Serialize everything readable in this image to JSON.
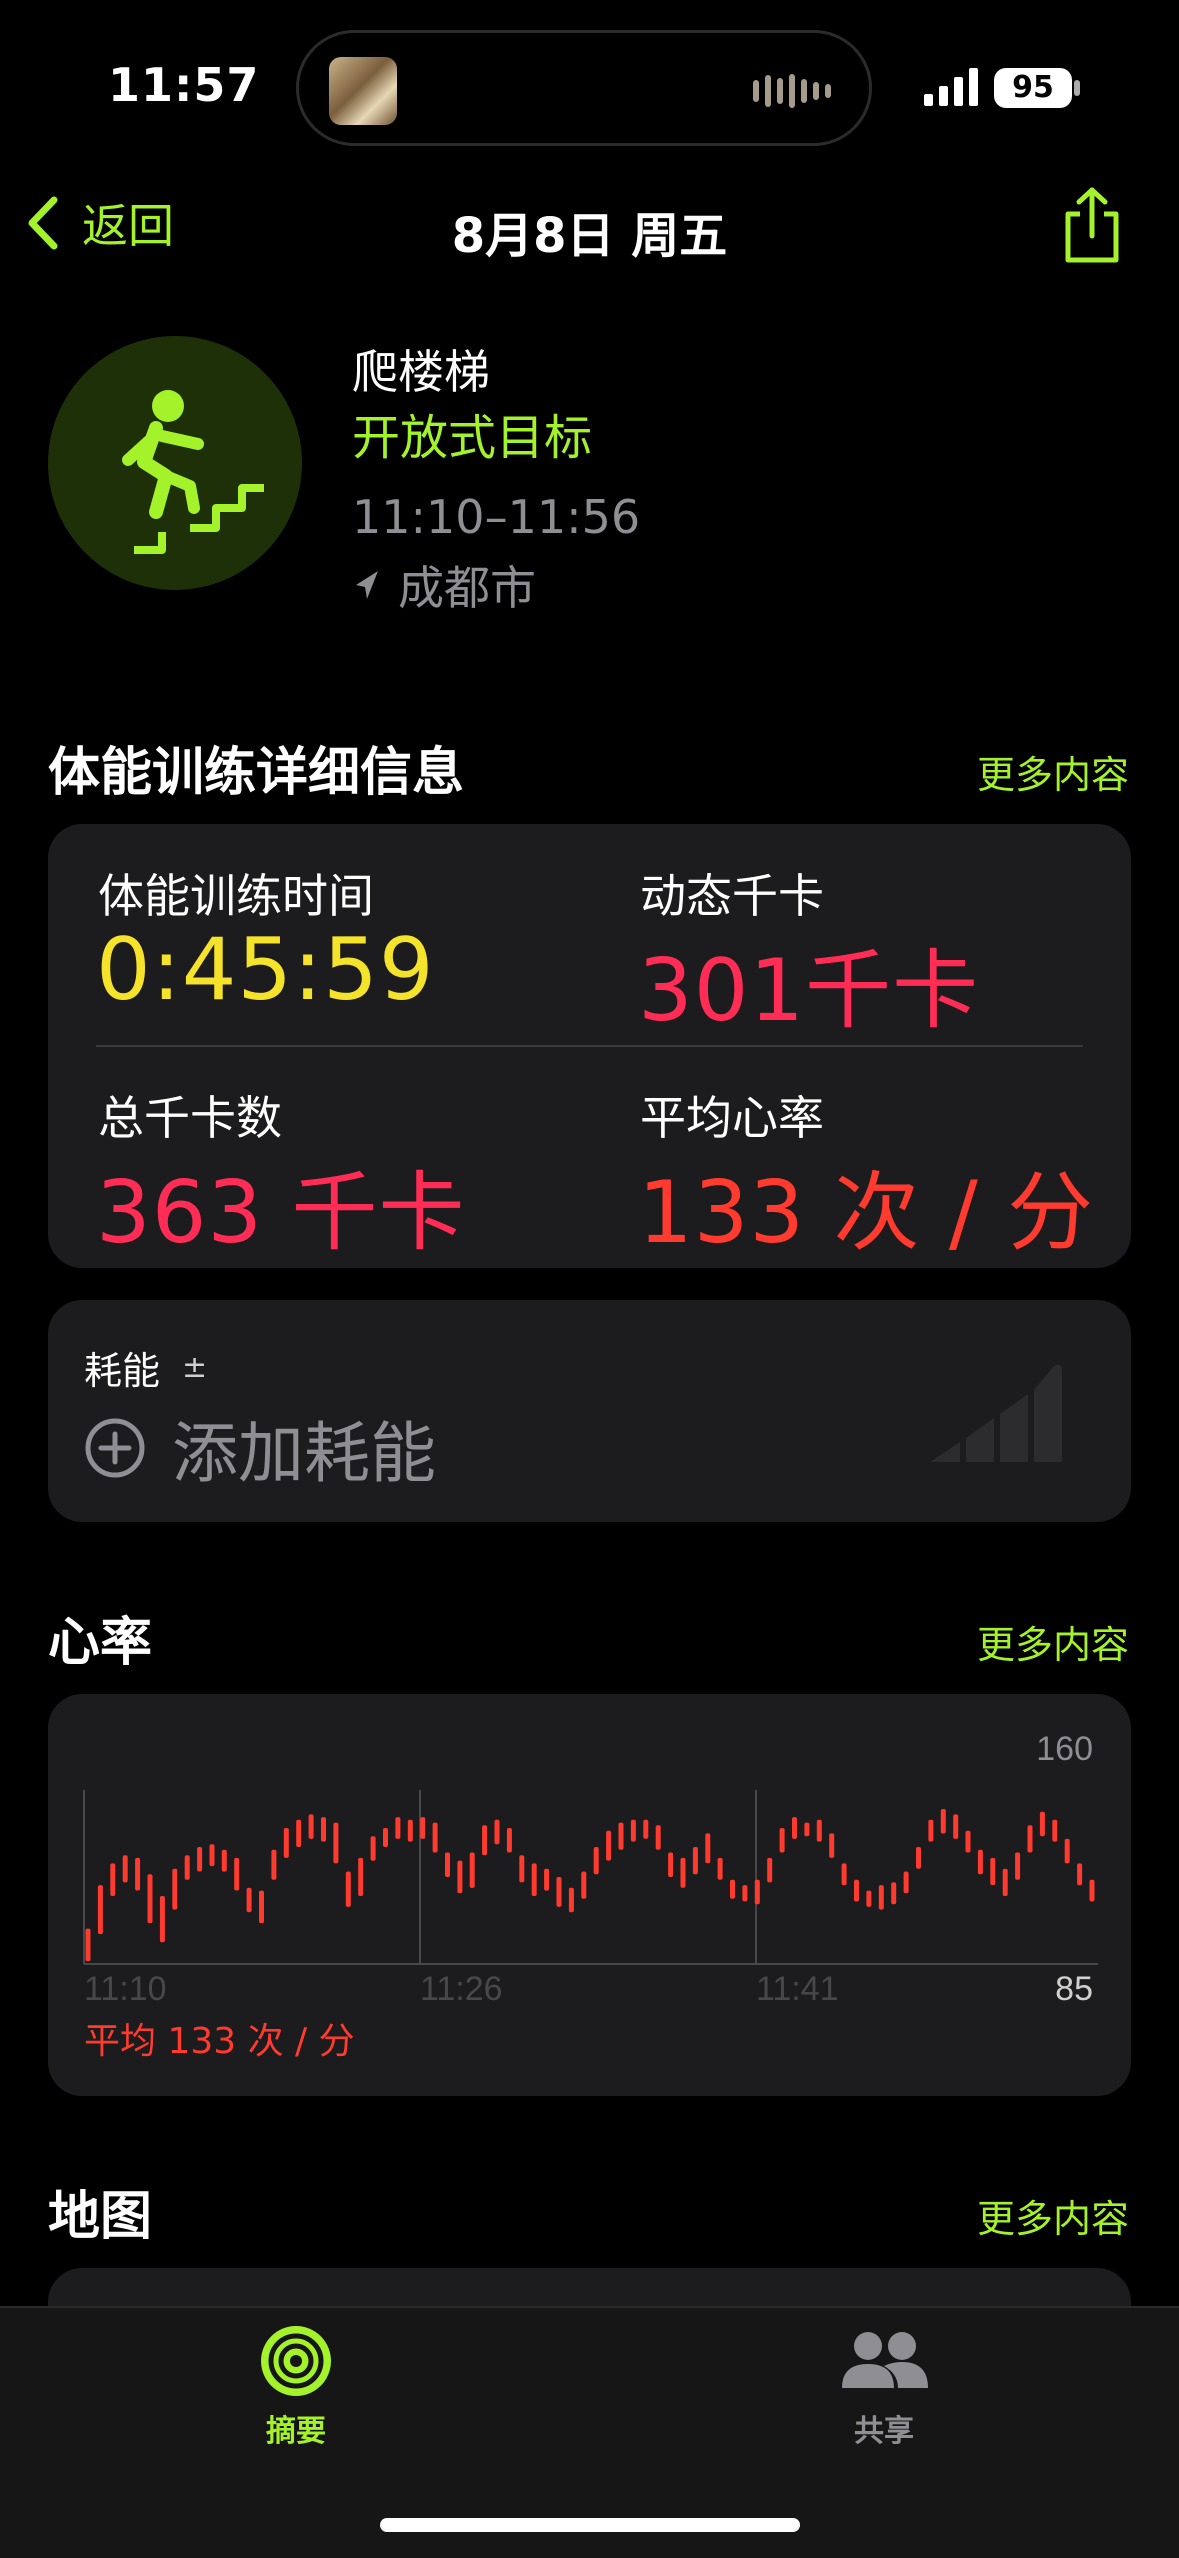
{
  "status": {
    "time": "11:57",
    "battery": "95"
  },
  "nav": {
    "back_label": "返回",
    "title": "8月8日 周五"
  },
  "workout": {
    "name": "爬楼梯",
    "goal": "开放式目标",
    "time_range": "11:10–11:56",
    "location": "成都市"
  },
  "details": {
    "title": "体能训练详细信息",
    "more": "更多内容",
    "duration_label": "体能训练时间",
    "duration_value": "0:45:59",
    "active_cal_label": "动态千卡",
    "active_cal_value": "301千卡",
    "total_cal_label": "总千卡数",
    "total_cal_value": "363 千卡",
    "avg_hr_label": "平均心率",
    "avg_hr_value": "133 次 / 分"
  },
  "effort": {
    "label": "耗能",
    "plus_minus": "±",
    "add_label": "添加耗能"
  },
  "heart_rate": {
    "title": "心率",
    "more": "更多内容",
    "max_label": "160",
    "min_label": "85",
    "avg_text": "平均 133 次 / 分"
  },
  "map": {
    "title": "地图",
    "more": "更多内容"
  },
  "tabs": [
    {
      "label": "摘要",
      "active": true
    },
    {
      "label": "共享",
      "active": false
    }
  ],
  "colors": {
    "accent_green": "#a3f22a",
    "duration_yellow": "#f5e22a",
    "calorie_pink": "#ff2d55",
    "heart_red": "#ff3b30"
  },
  "chart_data": {
    "type": "bar",
    "title": "心率",
    "x_tick_labels": [
      "11:10",
      "11:26",
      "11:41"
    ],
    "ylim": [
      85,
      160
    ],
    "y_tick_labels": [
      "160",
      "85"
    ],
    "average": 133,
    "unit": "次 / 分",
    "ranges": [
      [
        86,
        98
      ],
      [
        96,
        114
      ],
      [
        110,
        122
      ],
      [
        115,
        125
      ],
      [
        112,
        124
      ],
      [
        100,
        118
      ],
      [
        93,
        110
      ],
      [
        105,
        120
      ],
      [
        116,
        125
      ],
      [
        119,
        128
      ],
      [
        121,
        129
      ],
      [
        119,
        127
      ],
      [
        112,
        124
      ],
      [
        104,
        113
      ],
      [
        100,
        112
      ],
      [
        116,
        127
      ],
      [
        124,
        135
      ],
      [
        128,
        138
      ],
      [
        131,
        140
      ],
      [
        130,
        139
      ],
      [
        122,
        137
      ],
      [
        106,
        119
      ],
      [
        110,
        124
      ],
      [
        123,
        132
      ],
      [
        128,
        135
      ],
      [
        131,
        139
      ],
      [
        130,
        138
      ],
      [
        131,
        139
      ],
      [
        126,
        137
      ],
      [
        117,
        126
      ],
      [
        111,
        123
      ],
      [
        113,
        126
      ],
      [
        125,
        136
      ],
      [
        129,
        138
      ],
      [
        126,
        135
      ],
      [
        115,
        125
      ],
      [
        110,
        122
      ],
      [
        112,
        120
      ],
      [
        106,
        117
      ],
      [
        104,
        113
      ],
      [
        109,
        119
      ],
      [
        118,
        128
      ],
      [
        123,
        134
      ],
      [
        127,
        137
      ],
      [
        130,
        138
      ],
      [
        131,
        138
      ],
      [
        127,
        136
      ],
      [
        117,
        126
      ],
      [
        113,
        124
      ],
      [
        118,
        128
      ],
      [
        122,
        133
      ],
      [
        116,
        124
      ],
      [
        109,
        116
      ],
      [
        108,
        114
      ],
      [
        107,
        116
      ],
      [
        115,
        124
      ],
      [
        126,
        135
      ],
      [
        131,
        139
      ],
      [
        132,
        137
      ],
      [
        130,
        138
      ],
      [
        124,
        133
      ],
      [
        114,
        122
      ],
      [
        108,
        116
      ],
      [
        106,
        112
      ],
      [
        105,
        114
      ],
      [
        107,
        115
      ],
      [
        111,
        119
      ],
      [
        120,
        128
      ],
      [
        130,
        138
      ],
      [
        133,
        142
      ],
      [
        131,
        140
      ],
      [
        126,
        134
      ],
      [
        118,
        127
      ],
      [
        114,
        124
      ],
      [
        110,
        120
      ],
      [
        116,
        126
      ],
      [
        126,
        136
      ],
      [
        132,
        141
      ],
      [
        130,
        138
      ],
      [
        122,
        131
      ],
      [
        114,
        122
      ],
      [
        108,
        116
      ]
    ]
  }
}
